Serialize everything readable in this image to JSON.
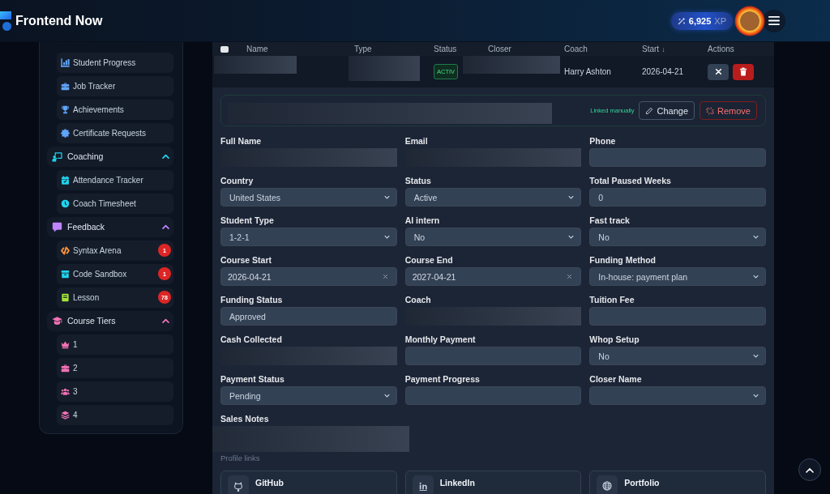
{
  "header": {
    "brand": "Frontend Now",
    "xp": {
      "value": "6,925",
      "unit": "XP"
    }
  },
  "sidebar": {
    "groups": [
      {
        "items": [
          {
            "label": "Student Progress",
            "color": "#60a5fa",
            "selected": false
          },
          {
            "label": "Job Tracker",
            "color": "#60a5fa",
            "selected": false
          },
          {
            "label": "Achievements",
            "color": "#60a5fa",
            "selected": false
          },
          {
            "label": "Certificate Requests",
            "color": "#60a5fa",
            "selected": false
          }
        ]
      },
      {
        "label": "Coaching",
        "color": "#22d3ee",
        "expanded": true,
        "items": [
          {
            "label": "Attendance Tracker",
            "color": "#22d3ee",
            "selected": false
          },
          {
            "label": "Coach Timesheet",
            "color": "#22d3ee",
            "selected": false
          }
        ]
      },
      {
        "label": "Feedback",
        "color": "#c084fc",
        "expanded": true,
        "items": [
          {
            "label": "Syntax Arena",
            "color": "#fb923c",
            "badge": "1",
            "selected": false
          },
          {
            "label": "Code Sandbox",
            "color": "#22d3ee",
            "badge": "1",
            "selected": false
          },
          {
            "label": "Lesson",
            "color": "#a3e635",
            "badge": "78",
            "selected": false
          }
        ]
      },
      {
        "label": "Course Tiers",
        "color": "#f472b6",
        "expanded": true,
        "items": [
          {
            "label": "1",
            "color": "#f472b6",
            "selected": false
          },
          {
            "label": "2",
            "color": "#f472b6",
            "selected": false
          },
          {
            "label": "3",
            "color": "#f472b6",
            "selected": false
          },
          {
            "label": "4",
            "color": "#f472b6",
            "selected": false
          }
        ]
      }
    ]
  },
  "table": {
    "select_all": {
      "checked": false
    },
    "columns": [
      {
        "label": "Name"
      },
      {
        "label": "Type"
      },
      {
        "label": "Status"
      },
      {
        "label": "Closer"
      },
      {
        "label": "Coach"
      },
      {
        "label": "Start",
        "sort_indicator": "↓"
      },
      {
        "label": "Actions"
      }
    ],
    "rows": [
      {
        "cells": [
          {
            "kind": "redacted"
          },
          {
            "kind": "redacted"
          },
          {
            "kind": "status",
            "text": "ACTIV"
          },
          {
            "kind": "redacted"
          },
          {
            "kind": "text",
            "text": "Harry Ashton"
          },
          {
            "kind": "text",
            "text": "2026-04-21"
          }
        ]
      }
    ]
  },
  "linked_account": {
    "redacted": true,
    "note": "Linked manually",
    "buttons": [
      {
        "label": "Change",
        "kind": "edit"
      },
      {
        "label": "Remove",
        "kind": "unlink"
      }
    ]
  },
  "form": {
    "fields": [
      {
        "label": "Full Name",
        "kind": "input",
        "redacted": true
      },
      {
        "label": "Email",
        "kind": "input",
        "redacted": true
      },
      {
        "label": "Phone",
        "kind": "input"
      },
      {
        "label": "Country",
        "kind": "select",
        "value": "United States"
      },
      {
        "label": "Status",
        "kind": "select",
        "value": "Active"
      },
      {
        "label": "Total Paused Weeks",
        "kind": "input",
        "value": "0"
      },
      {
        "label": "Student Type",
        "kind": "select",
        "value": "1-2-1"
      },
      {
        "label": "AI intern",
        "kind": "select",
        "value": "No"
      },
      {
        "label": "Fast track",
        "kind": "select",
        "value": "No"
      },
      {
        "label": "Course Start",
        "kind": "date",
        "value": "2026-04-21"
      },
      {
        "label": "Course End",
        "kind": "date",
        "value": "2027-04-21"
      },
      {
        "label": "Funding Method",
        "kind": "select",
        "value": "In-house: payment plan"
      },
      {
        "label": "Funding Status",
        "kind": "input",
        "value": "Approved"
      },
      {
        "label": "Coach",
        "kind": "input",
        "redacted": true
      },
      {
        "label": "Tuition Fee",
        "kind": "input"
      },
      {
        "label": "Cash Collected",
        "kind": "input",
        "redacted": true
      },
      {
        "label": "Monthly Payment",
        "kind": "input"
      },
      {
        "label": "Whop Setup",
        "kind": "select",
        "value": "No"
      },
      {
        "label": "Payment Status",
        "kind": "select",
        "value": "Pending"
      },
      {
        "label": "Payment Progress",
        "kind": "input"
      },
      {
        "label": "Closer Name",
        "kind": "select"
      }
    ],
    "notes": {
      "label": "Sales Notes",
      "redacted": true
    },
    "links_label": "Profile links",
    "links": [
      {
        "label": "GitHub"
      },
      {
        "label": "LinkedIn"
      },
      {
        "label": "Portfolio"
      }
    ]
  }
}
